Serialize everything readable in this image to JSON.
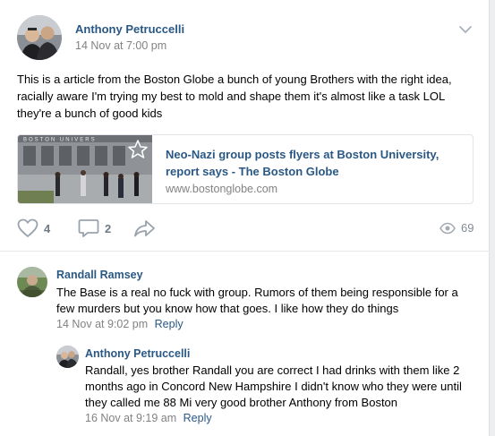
{
  "post": {
    "author": "Anthony Petruccelli",
    "timestamp": "14 Nov at 7:00 pm",
    "text": "This is a article from the Boston Globe a bunch of young Brothers with the right idea, racially aware I'm trying my best to mold and shape them it's almost like a task LOL they're a bunch of good kids",
    "link": {
      "title": "Neo-Nazi group posts flyers at Boston University, report says - The Boston Globe",
      "domain": "www.bostonglobe.com",
      "thumb_sign": "BOSTON UNIVERS"
    },
    "actions": {
      "likes": "4",
      "comments": "2",
      "views": "69"
    }
  },
  "comments": [
    {
      "author": "Randall Ramsey",
      "text": "The Base is a real no fuck with group. Rumors of them being responsible for a few murders but you know how that goes. I like how they do things",
      "timestamp": "14 Nov at 9:02 pm",
      "reply_label": "Reply"
    },
    {
      "author": "Anthony Petruccelli",
      "text": "Randall, yes brother Randall you are correct I had drinks with them like 2 months ago in Concord New Hampshire I didn't know who they were until they called me 88 Mi very good brother Anthony from Boston",
      "timestamp": "16 Nov at 9:19 am",
      "reply_label": "Reply"
    }
  ],
  "icons": {
    "like": "heart-icon",
    "comment": "comment-bubble-icon",
    "share": "share-arrow-icon",
    "views": "eye-icon",
    "bookmark": "star-icon",
    "menu": "chevron-down-icon"
  },
  "colors": {
    "link_blue": "#2a5885",
    "meta_gray": "#828282",
    "action_gray": "#6f7985"
  }
}
